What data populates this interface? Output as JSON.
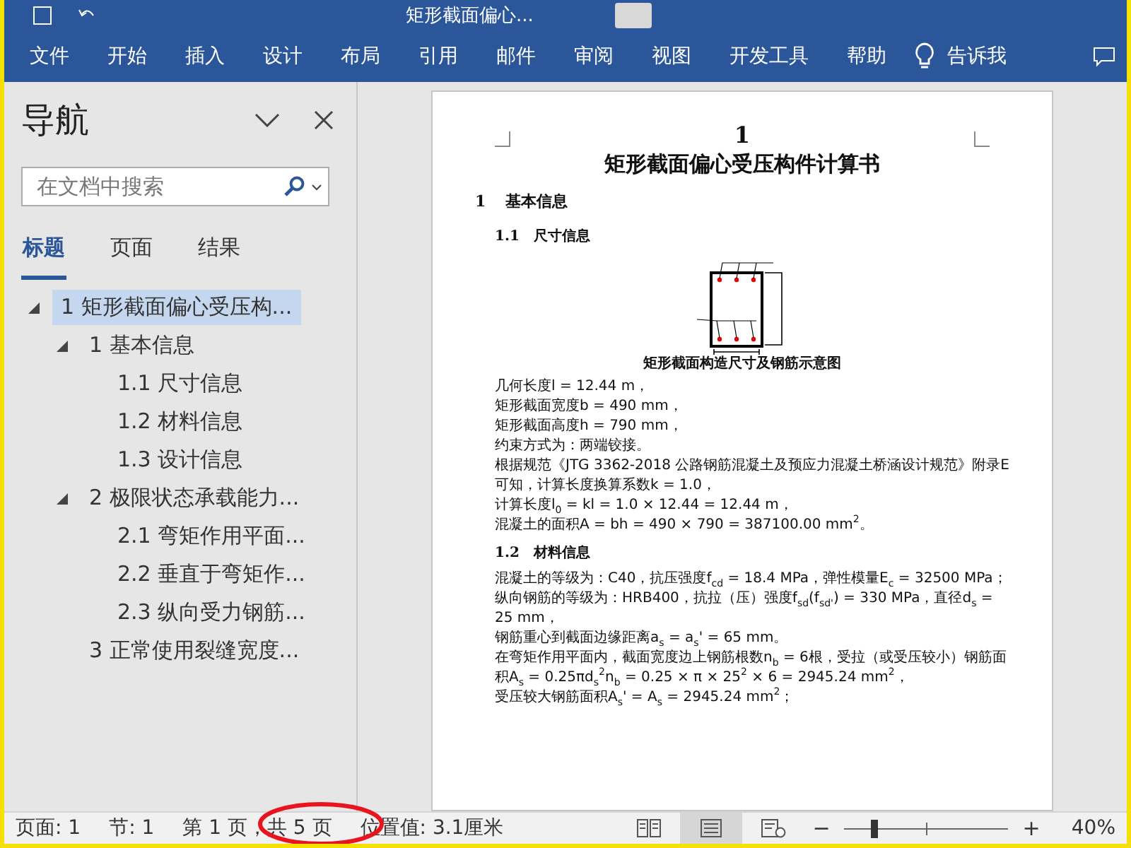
{
  "window": {
    "title": "矩形截面偏心..."
  },
  "ribbon_tabs": [
    "文件",
    "开始",
    "插入",
    "设计",
    "布局",
    "引用",
    "邮件",
    "审阅",
    "视图",
    "开发工具",
    "帮助"
  ],
  "tell_me": "告诉我",
  "navigation": {
    "title": "导航",
    "search": {
      "placeholder": "在文档中搜索"
    },
    "tabs": [
      {
        "label": "标题",
        "selected": true
      },
      {
        "label": "页面",
        "selected": false
      },
      {
        "label": "结果",
        "selected": false
      }
    ],
    "tree": [
      {
        "label": "1 矩形截面偏心受压构...",
        "selected": true,
        "expanded": true,
        "children": [
          {
            "label": "1 基本信息",
            "selected": false,
            "expanded": true,
            "children": [
              {
                "label": "1.1 尺寸信息",
                "selected": false
              },
              {
                "label": "1.2 材料信息",
                "selected": false
              },
              {
                "label": "1.3 设计信息",
                "selected": false
              }
            ]
          },
          {
            "label": "2 极限状态承载能力...",
            "selected": false,
            "expanded": true,
            "children": [
              {
                "label": "2.1 弯矩作用平面...",
                "selected": false
              },
              {
                "label": "2.2 垂直于弯矩作...",
                "selected": false
              },
              {
                "label": "2.3 纵向受力钢筋...",
                "selected": false
              }
            ]
          },
          {
            "label": "3 正常使用裂缝宽度...",
            "selected": false
          }
        ]
      }
    ]
  },
  "document": {
    "page_number": "1",
    "title": "矩形截面偏心受压构件计算书",
    "blocks": [
      {
        "kind": "heading1",
        "number": "1",
        "text": "基本信息"
      },
      {
        "kind": "heading2",
        "number": "1.1",
        "text": "尺寸信息"
      },
      {
        "kind": "figure",
        "caption": "矩形截面构造尺寸及钢筋示意图"
      },
      {
        "kind": "para",
        "text": "几何长度l = 12.44 m，"
      },
      {
        "kind": "para",
        "text": "矩形截面宽度b = 490 mm，"
      },
      {
        "kind": "para",
        "text": "矩形截面高度h = 790 mm，"
      },
      {
        "kind": "para",
        "text": "约束方式为：两端铰接。"
      },
      {
        "kind": "para",
        "text": "根据规范《JTG 3362-2018 公路钢筋混凝土及预应力混凝土桥涵设计规范》附录E可知，计算长度换算系数k = 1.0，"
      },
      {
        "kind": "para",
        "text": "计算长度l$_{0}$ = kl = 1.0 × 12.44 = 12.44 m，"
      },
      {
        "kind": "para",
        "text": "混凝土的面积A = bh = 490 × 790 = 387100.00 mm$^{2}$。"
      },
      {
        "kind": "heading2",
        "number": "1.2",
        "text": "材料信息"
      },
      {
        "kind": "para",
        "text": "混凝土的等级为：C40，抗压强度f$_{cd}$ = 18.4 MPa，弹性模量E$_{c}$ = 32500 MPa；"
      },
      {
        "kind": "para",
        "text": "纵向钢筋的等级为：HRB400，抗拉（压）强度f$_{sd}$(f$_{sd'}$) = 330 MPa，直径d$_{s}$ = 25 mm，"
      },
      {
        "kind": "para",
        "text": "钢筋重心到截面边缘距离a$_{s}$ = a$_{s}$' = 65 mm。"
      },
      {
        "kind": "para",
        "text": "在弯矩作用平面内，截面宽度边上钢筋根数n$_{b}$ = 6根，受拉（或受压较小）钢筋面积A$_{s}$ = 0.25πd$_{s}$$^{2}$n$_{b}$ = 0.25 × π × 25$^{2}$ × 6 = 2945.24 mm$^{2}$，"
      },
      {
        "kind": "para",
        "text": "受压较大钢筋面积A$_{s}$' = A$_{s}$ = 2945.24 mm$^{2}$；"
      }
    ]
  },
  "status_bar": {
    "items": [
      "页面: 1",
      "节: 1",
      "第 1 页，共 5 页",
      "位置值: 3.1厘米"
    ],
    "views": [
      {
        "kind": "read",
        "selected": false
      },
      {
        "kind": "print",
        "selected": true
      },
      {
        "kind": "web",
        "selected": false
      }
    ],
    "zoom": {
      "minus": "−",
      "plus": "+",
      "level": 0.18,
      "reading": "40%"
    }
  },
  "annotation": {
    "kind": "ellipse",
    "color": "#e8141e"
  }
}
